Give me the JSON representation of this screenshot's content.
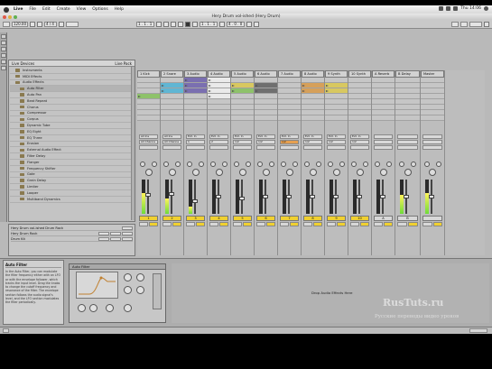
{
  "menubar": {
    "items": [
      "Live",
      "File",
      "Edit",
      "Create",
      "View",
      "Options",
      "Help"
    ],
    "clock": "Thu 14:06"
  },
  "window": {
    "title": "Hery Drum vol-ished (Hery Drum)"
  },
  "transport": {
    "tempo": "120.00",
    "signature": "4 / 4",
    "position": "1 . 1 . 1",
    "loop_length": "4 . 0 . 0"
  },
  "browser": {
    "title": "Live Devices",
    "sort_label": "Live Pack",
    "items": [
      {
        "label": "Instruments",
        "level": 1
      },
      {
        "label": "MIDI Effects",
        "level": 1
      },
      {
        "label": "Audio Effects",
        "level": 1
      },
      {
        "label": "Auto Filter",
        "level": 2
      },
      {
        "label": "Auto Pan",
        "level": 2
      },
      {
        "label": "Beat Repeat",
        "level": 2
      },
      {
        "label": "Chorus",
        "level": 2
      },
      {
        "label": "Compressor",
        "level": 2
      },
      {
        "label": "Corpus",
        "level": 2
      },
      {
        "label": "Dynamic Tube",
        "level": 2
      },
      {
        "label": "EQ Eight",
        "level": 2
      },
      {
        "label": "EQ Three",
        "level": 2
      },
      {
        "label": "Erosion",
        "level": 2
      },
      {
        "label": "External Audio Effect",
        "level": 2
      },
      {
        "label": "Filter Delay",
        "level": 2
      },
      {
        "label": "Flanger",
        "level": 2
      },
      {
        "label": "Frequency Shifter",
        "level": 2
      },
      {
        "label": "Gate",
        "level": 2
      },
      {
        "label": "Grain Delay",
        "level": 2
      },
      {
        "label": "Limiter",
        "level": 2
      },
      {
        "label": "Looper",
        "level": 2
      },
      {
        "label": "Multiband Dynamics",
        "level": 2
      }
    ]
  },
  "infobox": {
    "title": "Hery Drum vol-ished Drum Rack",
    "label_a": "Hery Drum Rack",
    "label_b": "Drum Kit"
  },
  "tracks": [
    {
      "name": "1 Kick",
      "clips": [
        "",
        "",
        "",
        "clip-green",
        "",
        "",
        "",
        ""
      ],
      "io_a": "All Ins",
      "io_b": "All Channe",
      "num": "1",
      "meter": 0.6,
      "fader": 0.55
    },
    {
      "name": "2 Snare",
      "clips": [
        "",
        "clip-blue",
        "clip-blue",
        "",
        "",
        "",
        "",
        ""
      ],
      "io_a": "All Ins",
      "io_b": "All Channe",
      "num": "2",
      "meter": 0.45,
      "fader": 0.6
    },
    {
      "name": "3 Audio",
      "clips": [
        "clip-purple",
        "clip-purple",
        "clip-purple",
        "",
        "",
        "",
        "",
        ""
      ],
      "io_a": "Ext. In",
      "io_b": "1",
      "num": "3",
      "meter": 0.2,
      "fader": 0.35
    },
    {
      "name": "4 Audio",
      "clips": [
        "clip-white",
        "clip-white",
        "clip-white",
        "clip-white",
        "",
        "",
        "",
        ""
      ],
      "io_a": "Ext. In",
      "io_b": "2",
      "num": "4",
      "meter": 0.0,
      "fader": 0.5
    },
    {
      "name": "5 Audio",
      "clips": [
        "",
        "clip-yellow",
        "clip-green",
        "",
        "",
        "",
        "",
        ""
      ],
      "io_a": "Ext. In",
      "io_b": "1/2",
      "num": "5",
      "meter": 0.0,
      "fader": 0.45
    },
    {
      "name": "6 Audio",
      "clips": [
        "",
        "clip-gray",
        "clip-gray",
        "",
        "",
        "",
        "",
        ""
      ],
      "io_a": "Ext. In",
      "io_b": "1/2",
      "num": "6",
      "meter": 0.0,
      "fader": 0.5
    },
    {
      "name": "7 Audio",
      "clips": [
        "",
        "",
        "",
        "",
        "",
        "",
        "",
        ""
      ],
      "io_a": "Ext. In",
      "io_b": "1/2",
      "num": "7",
      "meter": 0.0,
      "fader": 0.5
    },
    {
      "name": "8 Audio",
      "clips": [
        "",
        "clip-orange",
        "clip-orange",
        "",
        "",
        "",
        "",
        ""
      ],
      "io_a": "Ext. In",
      "io_b": "1/2",
      "num": "8",
      "meter": 0.0,
      "fader": 0.5
    },
    {
      "name": "9 Synth",
      "clips": [
        "",
        "clip-yellow",
        "clip-yellow",
        "",
        "",
        "",
        "",
        ""
      ],
      "io_a": "Ext. In",
      "io_b": "1/2",
      "num": "9",
      "meter": 0.0,
      "fader": 0.5
    },
    {
      "name": "10 Synth",
      "clips": [
        "",
        "",
        "",
        "",
        "",
        "",
        "",
        ""
      ],
      "io_a": "Ext. In",
      "io_b": "1/2",
      "num": "10",
      "meter": 0.0,
      "fader": 0.5
    },
    {
      "name": "A Reverb",
      "clips": [
        "",
        "",
        "",
        "",
        "",
        "",
        "",
        ""
      ],
      "io_a": "",
      "io_b": "",
      "num": "A",
      "meter": 0.0,
      "fader": 0.5
    },
    {
      "name": "B Delay",
      "clips": [
        "",
        "",
        "",
        "",
        "",
        "",
        "",
        ""
      ],
      "io_a": "",
      "io_b": "",
      "num": "B",
      "meter": 0.55,
      "fader": 0.5
    },
    {
      "name": "Master",
      "clips": [
        "",
        "",
        "",
        "",
        "",
        "",
        "",
        ""
      ],
      "io_a": "",
      "io_b": "",
      "num": "",
      "meter": 0.6,
      "fader": 0.5
    }
  ],
  "help": {
    "title": "Auto Filter",
    "text": "In the Auto Filter, you can modulate the filter frequency either with an LFO or with the envelope follower, which tracks the input level. Drag the knobs to change the cutoff frequency and resonance of the filter. The envelope section follows the audio signal's level, and the LFO section modulates the filter periodically."
  },
  "device": {
    "name": "Auto Filter"
  },
  "dropzone": {
    "text": "Drop Audio Effects Here"
  },
  "watermark": {
    "line1": "RusTuts.ru",
    "line2": "Русские переводы видео уроков"
  }
}
